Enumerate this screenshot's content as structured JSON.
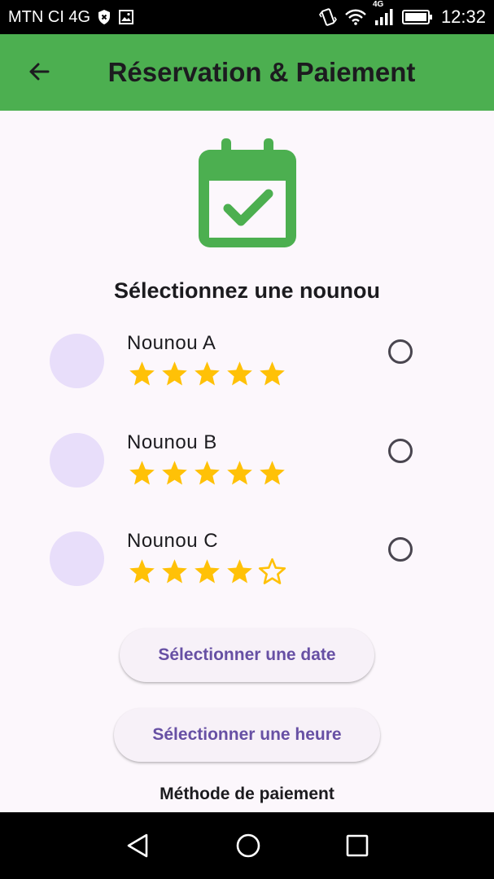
{
  "status_bar": {
    "carrier": "MTN CI 4G",
    "network_badge": "4G",
    "time": "12:32",
    "icons": [
      "shield-x-icon",
      "image-icon",
      "vibrate-icon",
      "wifi-icon",
      "signal-icon",
      "battery-icon"
    ]
  },
  "app_bar": {
    "title": "Réservation & Paiement",
    "back_icon": "arrow-left-icon",
    "color": "#4caf50"
  },
  "header": {
    "icon": "calendar-check-icon",
    "section_title": "Sélectionnez une nounou"
  },
  "nannies": [
    {
      "name": "Nounou A",
      "rating": 5,
      "max_rating": 5,
      "selected": false
    },
    {
      "name": "Nounou B",
      "rating": 5,
      "max_rating": 5,
      "selected": false
    },
    {
      "name": "Nounou C",
      "rating": 4,
      "max_rating": 5,
      "selected": false
    }
  ],
  "buttons": {
    "select_date": "Sélectionner une date",
    "select_time": "Sélectionner une heure"
  },
  "payment": {
    "label": "Méthode de paiement"
  },
  "colors": {
    "accent": "#4caf50",
    "star": "#ffc107",
    "button_text": "#6750a4",
    "avatar": "#e8defa"
  }
}
